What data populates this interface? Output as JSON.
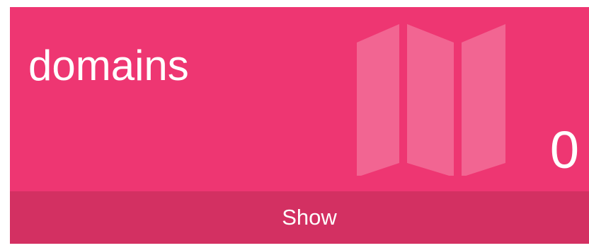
{
  "widget": {
    "title": "domains",
    "count": "0",
    "action_label": "Show",
    "icon": "map-icon",
    "colors": {
      "card_background": "#ee3672",
      "footer_background": "#d33062",
      "icon_fill": "#f26592",
      "text": "#ffffff"
    }
  }
}
